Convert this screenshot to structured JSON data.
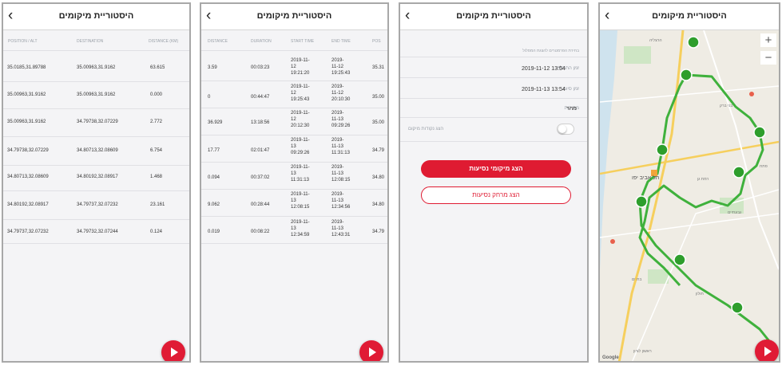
{
  "app": {
    "title": "היסטוריית מיקומים",
    "back_glyph": "‹"
  },
  "colors": {
    "accent": "#df1b32",
    "route": "#3fb13c",
    "pin": "#2e9e2c"
  },
  "screen1": {
    "headers": [
      "POSITION / ALT",
      "DESTINATION",
      "DISTANCE (KM)"
    ],
    "rows": [
      {
        "from": "35.0185,31.89788",
        "to": "35.00963,31.9162",
        "dist": "63.615"
      },
      {
        "from": "35.00963,31.9162",
        "to": "35.00963,31.9162",
        "dist": "0.000"
      },
      {
        "from": "35.00963,31.9162",
        "to": "34.79738,32.07229",
        "dist": "2.772"
      },
      {
        "from": "34.79738,32.07229",
        "to": "34.80713,32.08609",
        "dist": "6.754"
      },
      {
        "from": "34.80713,32.08609",
        "to": "34.80192,32.08917",
        "dist": "1.468"
      },
      {
        "from": "34.80192,32.08917",
        "to": "34.79737,32.07232",
        "dist": "23.161"
      },
      {
        "from": "34.79737,32.07232",
        "to": "34.79732,32.07244",
        "dist": "0.124"
      }
    ]
  },
  "screen2": {
    "headers": [
      "DISTANCE",
      "DURATION",
      "START TIME",
      "END TIME",
      "POS"
    ],
    "rows": [
      {
        "dist": "3.59",
        "dur": "00:03:23",
        "start": [
          "2019-11-",
          "12",
          "19:21:20"
        ],
        "end": [
          "2019-",
          "11-12",
          "19:25:43"
        ],
        "pos": "35.31"
      },
      {
        "dist": "0",
        "dur": "00:44:47",
        "start": [
          "2019-11-",
          "12",
          "19:25:43"
        ],
        "end": [
          "2019-",
          "11-12",
          "20:10:30"
        ],
        "pos": "35.00"
      },
      {
        "dist": "36.929",
        "dur": "13:18:56",
        "start": [
          "2019-11-",
          "12",
          "20:12:30"
        ],
        "end": [
          "2019-",
          "11-13",
          "09:29:26"
        ],
        "pos": "35.00"
      },
      {
        "dist": "17.77",
        "dur": "02:01:47",
        "start": [
          "2019-11-",
          "13",
          "09:29:26"
        ],
        "end": [
          "2019-",
          "11-13",
          "11:31:13"
        ],
        "pos": "34.79"
      },
      {
        "dist": "0.094",
        "dur": "00:37:02",
        "start": [
          "2019-11-",
          "13",
          "11:31:13"
        ],
        "end": [
          "2019-",
          "11-13",
          "12:08:15"
        ],
        "pos": "34.80"
      },
      {
        "dist": "9.062",
        "dur": "00:28:44",
        "start": [
          "2019-11-",
          "13",
          "12:08:15"
        ],
        "end": [
          "2019-",
          "11-13",
          "12:34:56"
        ],
        "pos": "34.80"
      },
      {
        "dist": "0.019",
        "dur": "00:08:22",
        "start": [
          "2019-11-",
          "13",
          "12:34:59"
        ],
        "end": [
          "2019-",
          "11-13",
          "12:43:31"
        ],
        "pos": "34.79"
      }
    ]
  },
  "screen3": {
    "section": "בחירת הפרמטרים להצגת המסלול",
    "start_label": "זמן התחלה",
    "start_value": "2019-11-12 13:54",
    "end_label": "זמן סיום",
    "end_value": "2019-11-13 13:54",
    "speed_label": "מהירות",
    "speed_value": "מהר",
    "show_label": "הצג נקודות מיקום",
    "btn_locations": "הצג מיקומי נסיעות",
    "btn_distance": "הצג מרחק נסיעות"
  },
  "screen4": {
    "labels": {
      "tel_aviv": "תל אביב יפו",
      "rishon": "ראשון לציון",
      "google": "Google",
      "holon": "חולון",
      "bat_yam": "בת ים",
      "ramat_gan": "רמת גן",
      "bnei_brak": "בני ברק",
      "givatayim": "גבעתיים",
      "ptah": "פתח",
      "herzliya": "הרצליה"
    },
    "zoom_in": "+",
    "zoom_out": "−"
  }
}
